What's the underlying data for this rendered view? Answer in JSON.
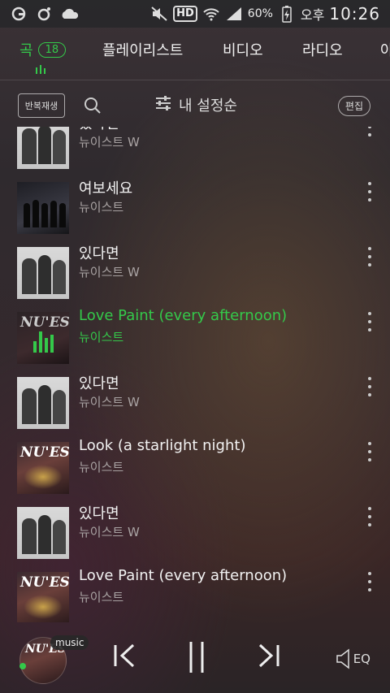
{
  "status_bar": {
    "battery": "60%",
    "ampm": "오후",
    "time": "10:26",
    "hd": "HD"
  },
  "tabs": [
    {
      "label": "곡",
      "count": "18"
    },
    {
      "label": "플레이리스트"
    },
    {
      "label": "비디오"
    },
    {
      "label": "라디오"
    },
    {
      "label": "아"
    }
  ],
  "controls": {
    "repeat": "반복재생",
    "sort": "내 설정순",
    "edit": "편집"
  },
  "songs": [
    {
      "title": "있다면",
      "artist": "뉴이스트 W"
    },
    {
      "title": "여보세요",
      "artist": "뉴이스트"
    },
    {
      "title": "있다면",
      "artist": "뉴이스트 W"
    },
    {
      "title": "Love Paint (every afternoon)",
      "artist": "뉴이스트"
    },
    {
      "title": "있다면",
      "artist": "뉴이스트 W"
    },
    {
      "title": "Look (a starlight night)",
      "artist": "뉴이스트"
    },
    {
      "title": "있다면",
      "artist": "뉴이스트 W"
    },
    {
      "title": "Love Paint (every afternoon)",
      "artist": "뉴이스트"
    }
  ],
  "album_logo": "NU'EST",
  "player": {
    "badge": "music",
    "eq": "EQ"
  },
  "colors": {
    "accent": "#34c94a"
  }
}
